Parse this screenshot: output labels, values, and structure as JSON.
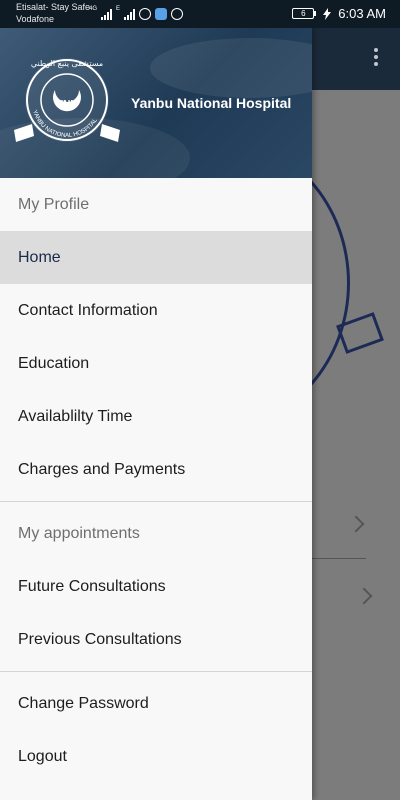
{
  "status_bar": {
    "carrier_primary": "Etisalat- Stay Safe",
    "carrier_secondary": "Vodafone",
    "network1": "4G",
    "network2": "E",
    "battery_level": "6",
    "time": "6:03 AM"
  },
  "header": {
    "hospital_name": "Yanbu National Hospital",
    "logo": {
      "abbreviation": "YNH",
      "ring_text": "YANBU NATIONAL HOSPITAL",
      "arabic_text": "مستشفى ينبع الوطني"
    }
  },
  "menu": {
    "section_profile": "My Profile",
    "profile_items": [
      {
        "label": "Home",
        "active": true
      },
      {
        "label": "Contact Information",
        "active": false
      },
      {
        "label": "Education",
        "active": false
      },
      {
        "label": "Availablilty Time",
        "active": false
      },
      {
        "label": "Charges and Payments",
        "active": false
      }
    ],
    "section_appointments": "My appointments",
    "appointment_items": [
      {
        "label": "Future Consultations"
      },
      {
        "label": "Previous Consultations"
      }
    ],
    "account_items": [
      {
        "label": "Change Password"
      },
      {
        "label": "Logout"
      }
    ]
  },
  "colors": {
    "toolbar": "#1b2a3a",
    "active_item_bg": "#dcdcdc",
    "active_item_text": "#1b2a48"
  }
}
